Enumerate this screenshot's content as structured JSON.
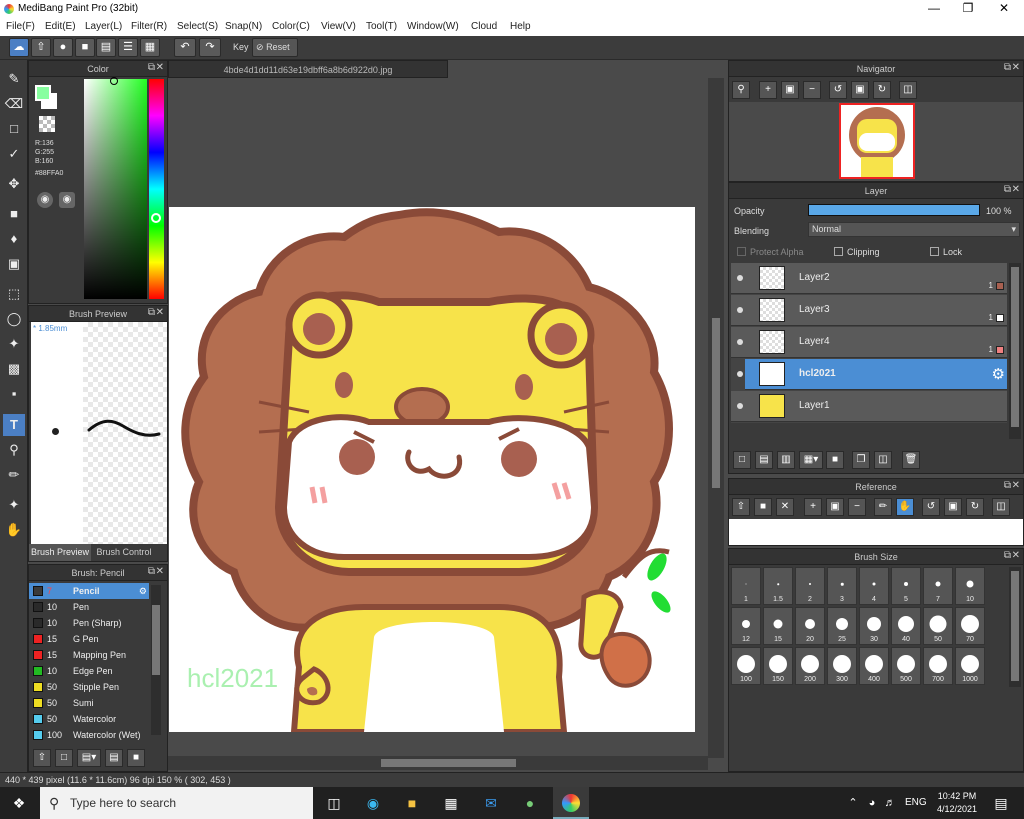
{
  "app": {
    "title": "MediBang Paint Pro (32bit)"
  },
  "menu": [
    "File(F)",
    "Edit(E)",
    "Layer(L)",
    "Filter(R)",
    "Select(S)",
    "Snap(N)",
    "Color(C)",
    "View(V)",
    "Tool(T)",
    "Window(W)",
    "Cloud",
    "Help"
  ],
  "toolbar": {
    "key_label": "Key",
    "reset_label": "Reset"
  },
  "color_panel": {
    "title": "Color",
    "r": "R:136",
    "g": "G:255",
    "b": "B:160",
    "hex": "#88FFA0",
    "fg_color": "#88FFA0"
  },
  "brush_preview": {
    "title": "Brush Preview",
    "size": "* 1.85mm",
    "tab_preview": "Brush Preview",
    "tab_control": "Brush Control"
  },
  "brush_list": {
    "title": "Brush: Pencil",
    "items": [
      {
        "size": "7",
        "name": "Pencil",
        "color": "#3a3a3a",
        "selected": true
      },
      {
        "size": "10",
        "name": "Pen",
        "color": "#2a2a2a"
      },
      {
        "size": "10",
        "name": "Pen (Sharp)",
        "color": "#2a2a2a"
      },
      {
        "size": "15",
        "name": "G Pen",
        "color": "#ee2222"
      },
      {
        "size": "15",
        "name": "Mapping Pen",
        "color": "#ee2222"
      },
      {
        "size": "10",
        "name": "Edge Pen",
        "color": "#22bb22"
      },
      {
        "size": "50",
        "name": "Stipple Pen",
        "color": "#eedd22"
      },
      {
        "size": "50",
        "name": "Sumi",
        "color": "#eedd22"
      },
      {
        "size": "50",
        "name": "Watercolor",
        "color": "#55ccee"
      },
      {
        "size": "100",
        "name": "Watercolor (Wet)",
        "color": "#55ccee"
      }
    ]
  },
  "document": {
    "filename": "4bde4d1dd11d63e19dbff6a8b6d922d0.jpg",
    "signature": "hcl2021"
  },
  "navigator": {
    "title": "Navigator"
  },
  "layer_panel": {
    "title": "Layer",
    "opacity_label": "Opacity",
    "opacity_value": "100 %",
    "opacity_fraction": 1.0,
    "blending_label": "Blending",
    "blending_value": "Normal",
    "protect_alpha": "Protect Alpha",
    "clipping": "Clipping",
    "lock": "Lock",
    "layers": [
      {
        "name": "Layer2",
        "opacity": "1",
        "swatch": "#a86050"
      },
      {
        "name": "Layer3",
        "opacity": "1",
        "swatch": "#ffffff"
      },
      {
        "name": "Layer4",
        "opacity": "1",
        "swatch": "#f08080"
      },
      {
        "name": "hcl2021",
        "opacity": "",
        "swatch": "",
        "selected": true
      },
      {
        "name": "Layer1",
        "opacity": "",
        "swatch": ""
      }
    ]
  },
  "reference": {
    "title": "Reference"
  },
  "brush_size": {
    "title": "Brush Size",
    "sizes": [
      "1",
      "1.5",
      "2",
      "3",
      "4",
      "5",
      "7",
      "10",
      "12",
      "15",
      "20",
      "25",
      "30",
      "40",
      "50",
      "70",
      "100",
      "150",
      "200",
      "300",
      "400",
      "500",
      "700",
      "1000"
    ]
  },
  "status": {
    "text": "440 * 439 pixel  (11.6 * 11.6cm)  96 dpi  150 %  ( 302, 453 )"
  },
  "taskbar": {
    "search_placeholder": "Type here to search",
    "lang": "ENG",
    "time": "10:42 PM",
    "date": "4/12/2021"
  }
}
